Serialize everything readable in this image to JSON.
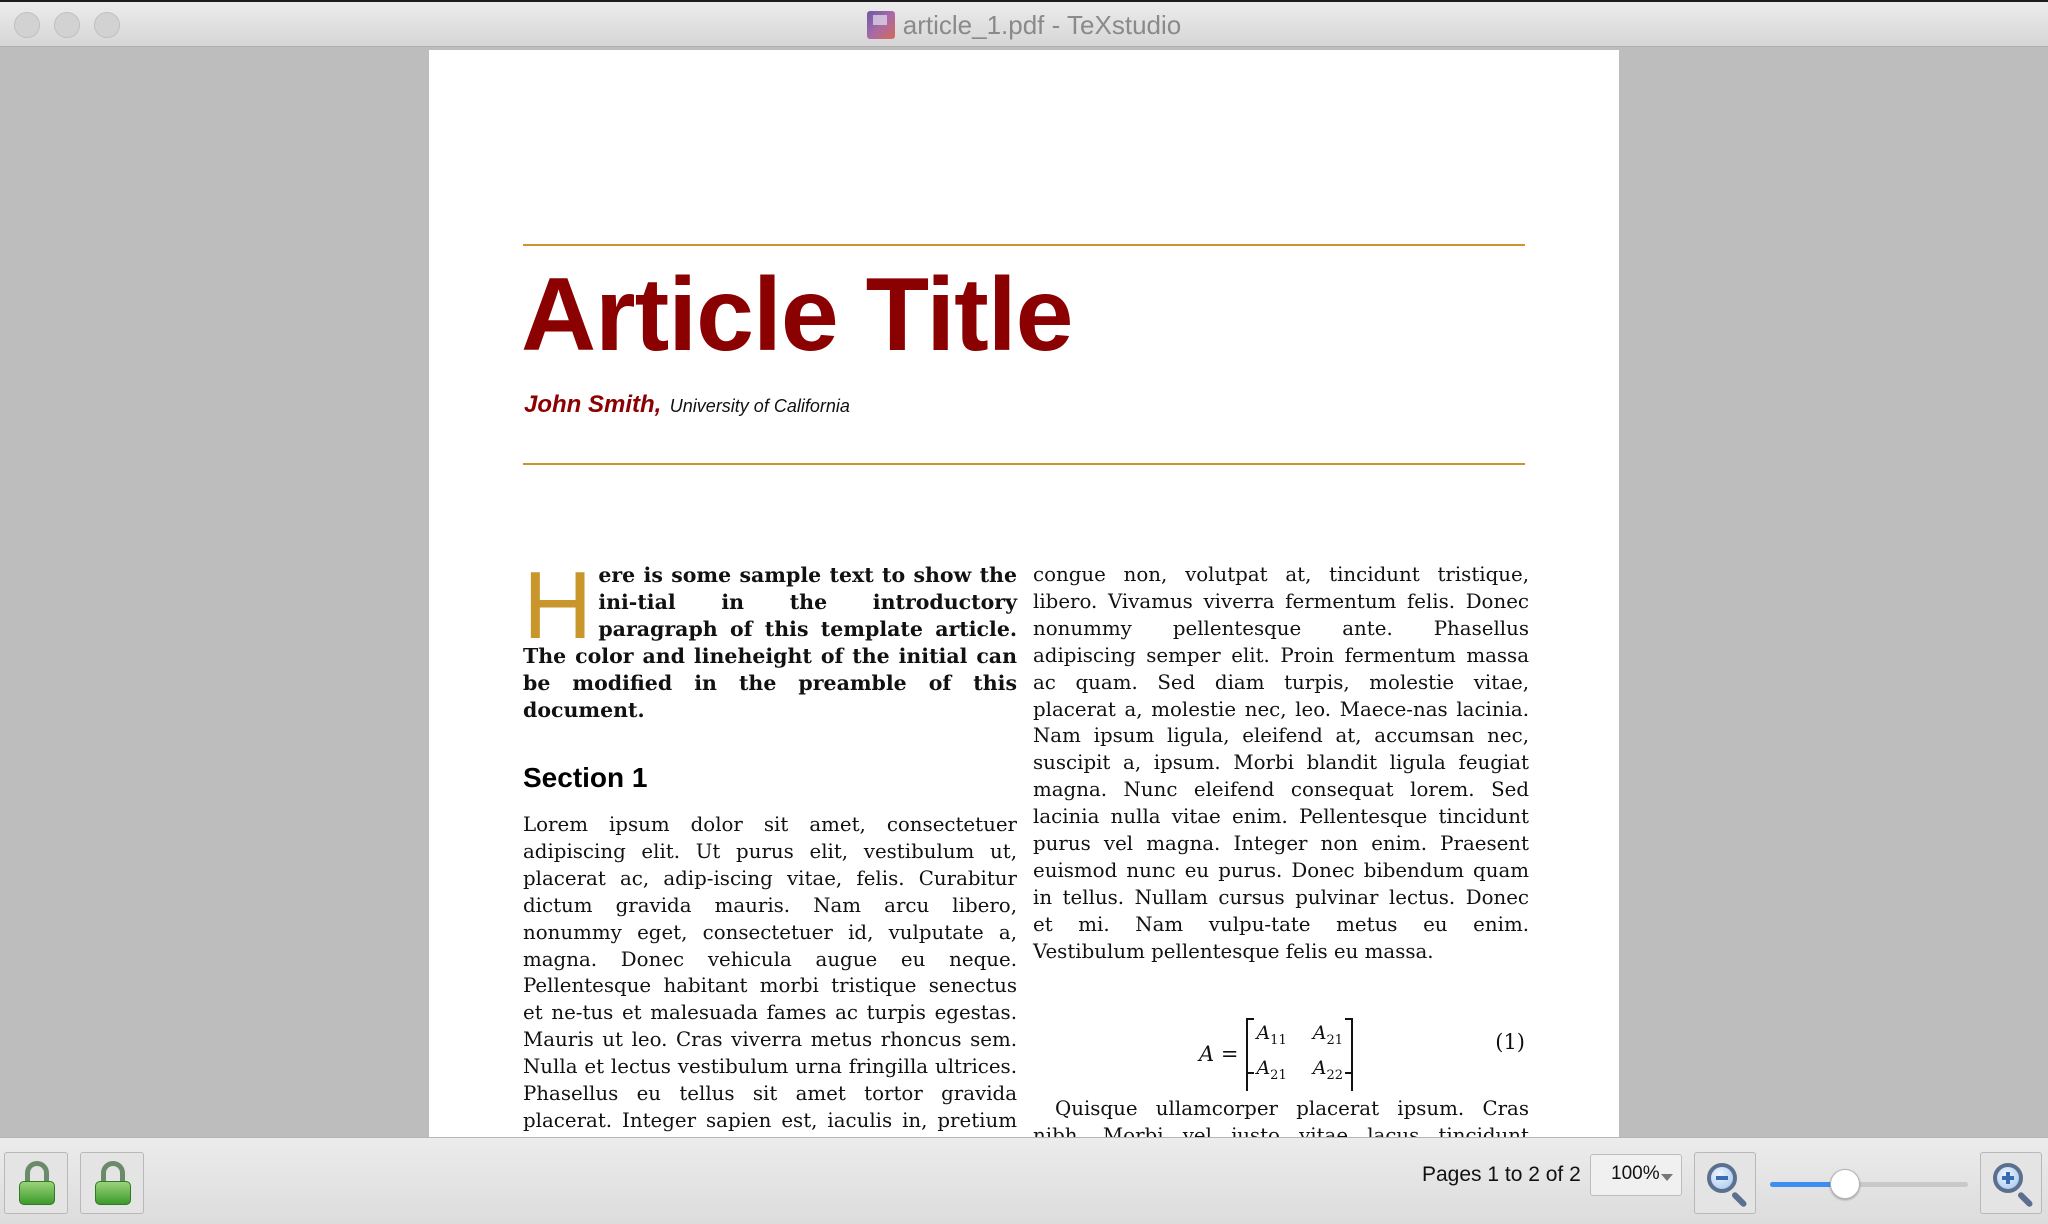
{
  "window": {
    "title": "article_1.pdf - TeXstudio",
    "icon": "texstudio-document-icon"
  },
  "document": {
    "title": "Article Title",
    "author": "John Smith,",
    "affiliation": "University of California",
    "intro_initial": "H",
    "intro_text": "ere is some sample text to show the ini-tial in the introductory paragraph of this template article. The color and lineheight of the initial can be modified in the preamble of this document.",
    "section_heading": "Section 1",
    "left_body": "Lorem ipsum dolor sit amet, consectetuer adipiscing elit. Ut purus elit, vestibulum ut, placerat ac, adip-iscing vitae, felis. Curabitur dictum gravida mauris. Nam arcu libero, nonummy eget, consectetuer id, vulputate a, magna. Donec vehicula augue eu neque. Pellentesque habitant morbi tristique senectus et ne-tus et malesuada fames ac turpis egestas. Mauris ut leo. Cras viverra metus rhoncus sem. Nulla et lectus vestibulum urna fringilla ultrices. Phasellus eu tellus sit amet tortor gravida placerat. Integer sapien est, iaculis in, pretium quis, viverra ac, nunc. Praesent eget sem vel leo ultrices bibendum. Aenean faucibus. Morbi dolor nulla, malesuada eu, pulvinar",
    "right_body": "congue non, volutpat at, tincidunt tristique, libero. Vivamus viverra fermentum felis. Donec nonummy pellentesque ante. Phasellus adipiscing semper elit. Proin fermentum massa ac quam. Sed diam turpis, molestie vitae, placerat a, molestie nec, leo. Maece-nas lacinia. Nam ipsum ligula, eleifend at, accumsan nec, suscipit a, ipsum. Morbi blandit ligula feugiat magna. Nunc eleifend consequat lorem. Sed lacinia nulla vitae enim. Pellentesque tincidunt purus vel magna. Integer non enim. Praesent euismod nunc eu purus. Donec bibendum quam in tellus. Nullam cursus pulvinar lectus. Donec et mi. Nam vulpu-tate metus eu enim. Vestibulum pellentesque felis eu massa.",
    "equation": {
      "lhs": "A =",
      "m11": "A",
      "m11_sub": "11",
      "m12": "A",
      "m12_sub": "21",
      "m21": "A",
      "m21_sub": "21",
      "m22": "A",
      "m22_sub": "22",
      "number": "(1)"
    },
    "right_body_2": "Quisque ullamcorper placerat ipsum. Cras nibh. Morbi vel justo vitae lacus tincidunt ultrices. Lorem ipsum dolor sit amet, consectetuer adipiscing elit."
  },
  "colors": {
    "title_red": "#8b0000",
    "rule_gold": "#c8962a",
    "slider_blue": "#3d8ef0"
  },
  "toolbar": {
    "lock_button_1_icon": "lock-icon",
    "lock_button_2_icon": "lock-icon",
    "pages_label": "Pages 1 to 2 of 2",
    "zoom_value": "100%",
    "zoom_out_icon": "zoom-out-icon",
    "zoom_in_icon": "zoom-in-icon",
    "zoom_slider_level": 0.38
  }
}
